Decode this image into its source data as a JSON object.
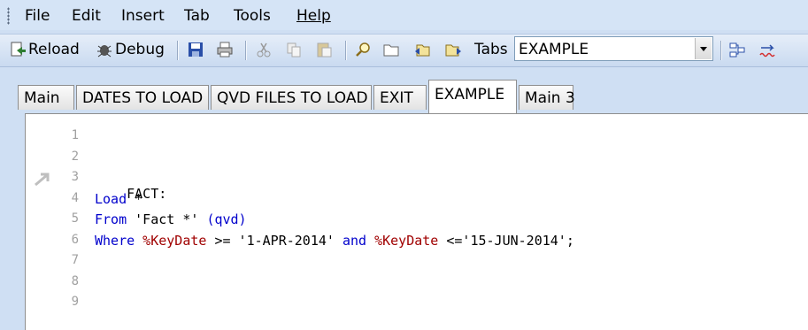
{
  "menu": {
    "items": [
      {
        "label": "File"
      },
      {
        "label": "Edit"
      },
      {
        "label": "Insert"
      },
      {
        "label": "Tab"
      },
      {
        "label": "Tools"
      },
      {
        "label": "Help"
      }
    ]
  },
  "toolbar": {
    "reload_label": "Reload",
    "debug_label": "Debug",
    "tabs_label": "Tabs",
    "tabs_selected": "EXAMPLE"
  },
  "tabs": [
    {
      "label": "Main"
    },
    {
      "label": "DATES TO LOAD"
    },
    {
      "label": "QVD FILES TO LOAD"
    },
    {
      "label": "EXIT"
    },
    {
      "label": "EXAMPLE"
    },
    {
      "label": "Main 3"
    }
  ],
  "editor": {
    "line_numbers": [
      "1",
      "2",
      "3",
      "4",
      "5",
      "6",
      "7",
      "8",
      "9"
    ],
    "code": {
      "l3": "FACT:",
      "l4_kw": "Load",
      "l4_rest": " *",
      "l5_kw": "From",
      "l5_str": " 'Fact *' ",
      "l5_qvd": "(qvd)",
      "l6_kw": "Where",
      "l6_var1": " %KeyDate",
      "l6_op1": " >= '1-APR-2014' ",
      "l6_and": "and",
      "l6_var2": " %KeyDate",
      "l6_op2": " <='15-JUN-2014';"
    }
  },
  "colors": {
    "keyword": "#0000cc",
    "variable": "#a00000"
  }
}
